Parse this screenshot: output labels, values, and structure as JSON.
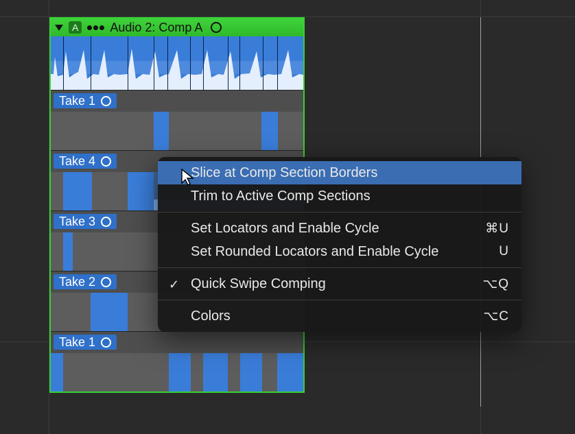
{
  "folder_header": {
    "title": "Audio 2: Comp A",
    "badge": "A"
  },
  "takes": [
    {
      "label": "Take 1"
    },
    {
      "label": "Take 4"
    },
    {
      "label": "Take 3"
    },
    {
      "label": "Take 2"
    },
    {
      "label": "Take 1"
    }
  ],
  "context_menu": {
    "items": [
      {
        "label": "Slice at Comp Section Borders",
        "shortcut": "",
        "highlighted": true,
        "checked": false
      },
      {
        "label": "Trim to Active Comp Sections",
        "shortcut": "",
        "highlighted": false,
        "checked": false
      }
    ],
    "items2": [
      {
        "label": "Set Locators and Enable Cycle",
        "shortcut": "⌘U",
        "checked": false
      },
      {
        "label": "Set Rounded Locators and Enable Cycle",
        "shortcut": "U",
        "checked": false
      }
    ],
    "items3": [
      {
        "label": "Quick Swipe Comping",
        "shortcut": "⌥Q",
        "checked": true
      }
    ],
    "items4": [
      {
        "label": "Colors",
        "shortcut": "⌥C",
        "checked": false
      }
    ]
  }
}
